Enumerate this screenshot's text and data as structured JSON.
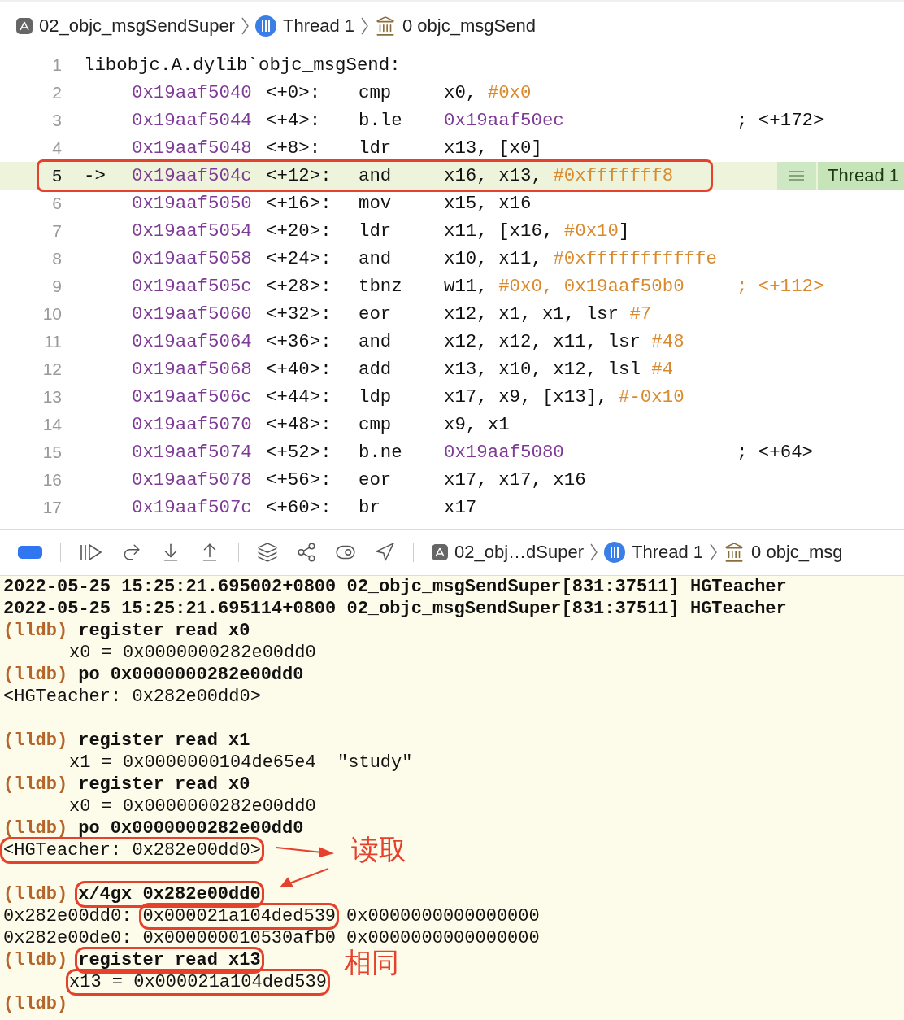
{
  "jump_bar": [
    {
      "kind": "app",
      "label": "02_objc_msgSendSuper"
    },
    {
      "kind": "thread",
      "label": "Thread 1"
    },
    {
      "kind": "frame",
      "label": "0 objc_msgSend"
    }
  ],
  "disassembly": [
    {
      "num": "1",
      "kind": "label",
      "text": "libobjc.A.dylib`objc_msgSend:",
      "current": false,
      "boxed": false
    },
    {
      "num": "2",
      "kind": "instruction",
      "address": "0x19aaf5040",
      "offset": "<+0>:",
      "mnemonic": "cmp",
      "operands": [
        {
          "text": "x0, ",
          "kind": "plain"
        },
        {
          "text": "#0x0",
          "kind": "literal"
        }
      ],
      "current": false,
      "boxed": false
    },
    {
      "num": "3",
      "kind": "instruction",
      "address": "0x19aaf5044",
      "offset": "<+4>:",
      "mnemonic": "b.le",
      "operands": [
        {
          "text": "0x19aaf50ec",
          "kind": "address"
        }
      ],
      "comment": {
        "text": "; <+172>",
        "kind": "plain"
      },
      "current": false,
      "boxed": false
    },
    {
      "num": "4",
      "kind": "instruction",
      "address": "0x19aaf5048",
      "offset": "<+8>:",
      "mnemonic": "ldr",
      "operands": [
        {
          "text": "x13, [x0]",
          "kind": "plain"
        }
      ],
      "current": false,
      "boxed": false
    },
    {
      "num": "5",
      "kind": "instruction",
      "pc_arrow": "->",
      "address": "0x19aaf504c",
      "offset": "<+12>:",
      "mnemonic": "and",
      "operands": [
        {
          "text": "x16, x13, ",
          "kind": "plain"
        },
        {
          "text": "#0xfffffff8",
          "kind": "literal"
        }
      ],
      "badge": "Thread 1",
      "current": true,
      "boxed": true
    },
    {
      "num": "6",
      "kind": "instruction",
      "address": "0x19aaf5050",
      "offset": "<+16>:",
      "mnemonic": "mov",
      "operands": [
        {
          "text": "x15, x16",
          "kind": "plain"
        }
      ],
      "current": false,
      "boxed": false
    },
    {
      "num": "7",
      "kind": "instruction",
      "address": "0x19aaf5054",
      "offset": "<+20>:",
      "mnemonic": "ldr",
      "operands": [
        {
          "text": "x11, [x16, ",
          "kind": "plain"
        },
        {
          "text": "#0x10",
          "kind": "literal"
        },
        {
          "text": "]",
          "kind": "plain"
        }
      ],
      "current": false,
      "boxed": false
    },
    {
      "num": "8",
      "kind": "instruction",
      "address": "0x19aaf5058",
      "offset": "<+24>:",
      "mnemonic": "and",
      "operands": [
        {
          "text": "x10, x11, ",
          "kind": "plain"
        },
        {
          "text": "#0xfffffffffffe",
          "kind": "literal"
        }
      ],
      "current": false,
      "boxed": false
    },
    {
      "num": "9",
      "kind": "instruction",
      "address": "0x19aaf505c",
      "offset": "<+28>:",
      "mnemonic": "tbnz",
      "operands": [
        {
          "text": "w11, ",
          "kind": "plain"
        },
        {
          "text": "#0x0, 0x19aaf50b0",
          "kind": "literal"
        }
      ],
      "comment": {
        "text": "; <+112>",
        "kind": "literal"
      },
      "current": false,
      "boxed": false
    },
    {
      "num": "10",
      "kind": "instruction",
      "address": "0x19aaf5060",
      "offset": "<+32>:",
      "mnemonic": "eor",
      "operands": [
        {
          "text": "x12, x1, x1, lsr ",
          "kind": "plain"
        },
        {
          "text": "#7",
          "kind": "literal"
        }
      ],
      "current": false,
      "boxed": false
    },
    {
      "num": "11",
      "kind": "instruction",
      "address": "0x19aaf5064",
      "offset": "<+36>:",
      "mnemonic": "and",
      "operands": [
        {
          "text": "x12, x12, x11, lsr ",
          "kind": "plain"
        },
        {
          "text": "#48",
          "kind": "literal"
        }
      ],
      "current": false,
      "boxed": false
    },
    {
      "num": "12",
      "kind": "instruction",
      "address": "0x19aaf5068",
      "offset": "<+40>:",
      "mnemonic": "add",
      "operands": [
        {
          "text": "x13, x10, x12, lsl ",
          "kind": "plain"
        },
        {
          "text": "#4",
          "kind": "literal"
        }
      ],
      "current": false,
      "boxed": false
    },
    {
      "num": "13",
      "kind": "instruction",
      "address": "0x19aaf506c",
      "offset": "<+44>:",
      "mnemonic": "ldp",
      "operands": [
        {
          "text": "x17, x9, [x13], ",
          "kind": "plain"
        },
        {
          "text": "#-0x10",
          "kind": "literal"
        }
      ],
      "current": false,
      "boxed": false
    },
    {
      "num": "14",
      "kind": "instruction",
      "address": "0x19aaf5070",
      "offset": "<+48>:",
      "mnemonic": "cmp",
      "operands": [
        {
          "text": "x9, x1",
          "kind": "plain"
        }
      ],
      "current": false,
      "boxed": false
    },
    {
      "num": "15",
      "kind": "instruction",
      "address": "0x19aaf5074",
      "offset": "<+52>:",
      "mnemonic": "b.ne",
      "operands": [
        {
          "text": "0x19aaf5080",
          "kind": "address"
        }
      ],
      "comment": {
        "text": "; <+64>",
        "kind": "plain"
      },
      "current": false,
      "boxed": false
    },
    {
      "num": "16",
      "kind": "instruction",
      "address": "0x19aaf5078",
      "offset": "<+56>:",
      "mnemonic": "eor",
      "operands": [
        {
          "text": "x17, x17, x16",
          "kind": "plain"
        }
      ],
      "current": false,
      "boxed": false
    },
    {
      "num": "17",
      "kind": "instruction",
      "address": "0x19aaf507c",
      "offset": "<+60>:",
      "mnemonic": "br",
      "operands": [
        {
          "text": "x17",
          "kind": "plain"
        }
      ],
      "current": false,
      "boxed": false
    }
  ],
  "debug_bar": {
    "breakpoints_active": true,
    "jump_bar": [
      {
        "kind": "app",
        "label": "02_obj…dSuper"
      },
      {
        "kind": "thread",
        "label": "Thread 1"
      },
      {
        "kind": "frame",
        "label": "0 objc_msg"
      }
    ]
  },
  "console": [
    {
      "kind": "log",
      "segments": [
        {
          "text": "2022-05-25 15:25:21.695002+0800 02_objc_msgSendSuper[831:37511] HGTeacher",
          "boxed": false
        }
      ]
    },
    {
      "kind": "log",
      "segments": [
        {
          "text": "2022-05-25 15:25:21.695114+0800 02_objc_msgSendSuper[831:37511] HGTeacher",
          "boxed": false
        }
      ]
    },
    {
      "kind": "command",
      "prompt": "(lldb)",
      "segments": [
        {
          "text": "register read x0",
          "boxed": false
        }
      ]
    },
    {
      "kind": "register",
      "segments": [
        {
          "text": "x0 = 0x0000000282e00dd0",
          "boxed": false
        }
      ]
    },
    {
      "kind": "command",
      "prompt": "(lldb)",
      "segments": [
        {
          "text": "po 0x0000000282e00dd0",
          "boxed": false
        }
      ]
    },
    {
      "kind": "output",
      "segments": [
        {
          "text": "<HGTeacher: 0x282e00dd0>",
          "boxed": false
        }
      ]
    },
    {
      "kind": "blank"
    },
    {
      "kind": "command",
      "prompt": "(lldb)",
      "segments": [
        {
          "text": "register read x1",
          "boxed": false
        }
      ]
    },
    {
      "kind": "register",
      "segments": [
        {
          "text": "x1 = 0x0000000104de65e4  \"study\"",
          "boxed": false
        }
      ]
    },
    {
      "kind": "command",
      "prompt": "(lldb)",
      "segments": [
        {
          "text": "register read x0",
          "boxed": false
        }
      ]
    },
    {
      "kind": "register",
      "segments": [
        {
          "text": "x0 = 0x0000000282e00dd0",
          "boxed": false
        }
      ]
    },
    {
      "kind": "command",
      "prompt": "(lldb)",
      "segments": [
        {
          "text": "po 0x0000000282e00dd0",
          "boxed": false
        }
      ]
    },
    {
      "kind": "output",
      "segments": [
        {
          "text": "<HGTeacher: 0x282e00dd0>",
          "boxed": true
        }
      ],
      "note": "读取"
    },
    {
      "kind": "blank"
    },
    {
      "kind": "command",
      "prompt": "(lldb)",
      "segments": [
        {
          "text": "x/4gx 0x282e00dd0",
          "boxed": true
        }
      ]
    },
    {
      "kind": "output",
      "segments": [
        {
          "text": "0x282e00dd0:",
          "boxed": false
        },
        {
          "text": "0x000021a104ded539",
          "boxed": true
        },
        {
          "text": "0x0000000000000000",
          "boxed": false
        }
      ]
    },
    {
      "kind": "output",
      "segments": [
        {
          "text": "0x282e00de0:",
          "boxed": false
        },
        {
          "text": "0x000000010530afb0",
          "boxed": false
        },
        {
          "text": "0x0000000000000000",
          "boxed": false
        }
      ]
    },
    {
      "kind": "command",
      "prompt": "(lldb)",
      "segments": [
        {
          "text": "register read x13",
          "boxed": true
        }
      ],
      "note": "相同"
    },
    {
      "kind": "register",
      "segments": [
        {
          "text": "x13 = 0x000021a104ded539",
          "boxed": true
        }
      ]
    },
    {
      "kind": "command",
      "prompt": "(lldb)"
    }
  ]
}
